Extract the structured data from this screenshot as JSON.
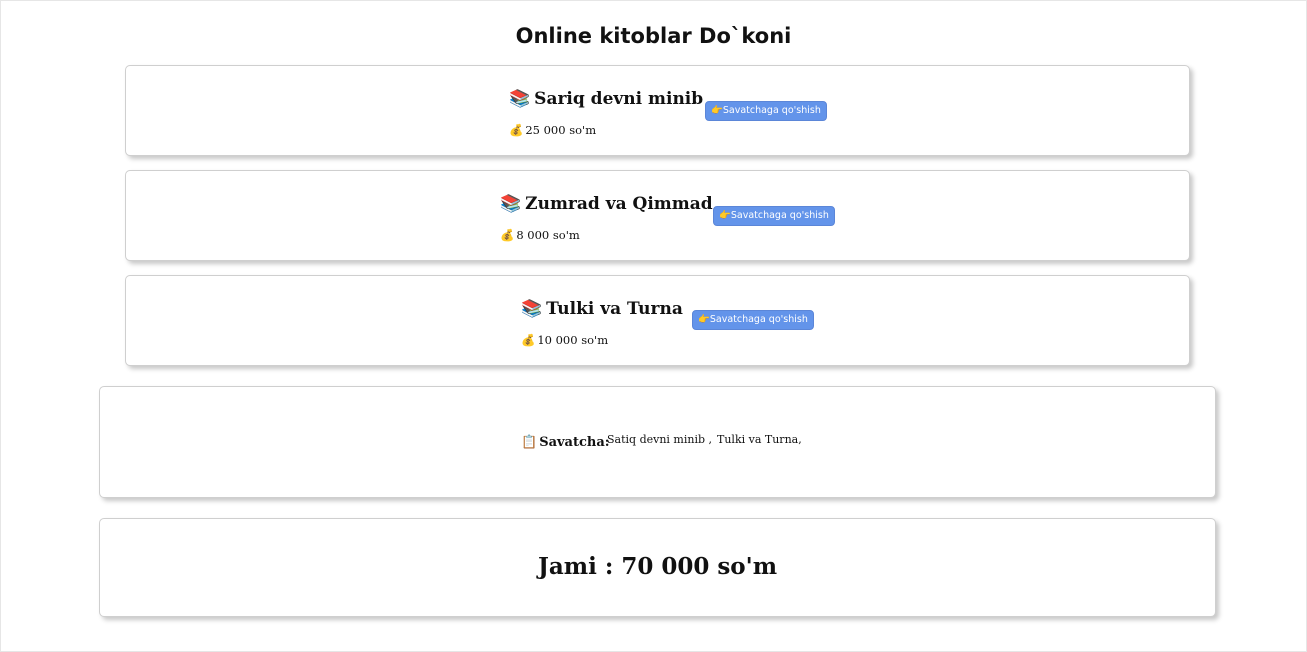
{
  "page": {
    "title": "Online kitoblar Do`koni"
  },
  "icons": {
    "book": "📚",
    "money": "💰",
    "pointer": "👉",
    "clipboard": "📋"
  },
  "books": [
    {
      "title": "Sariq devni minib",
      "price": "25 000 so'm",
      "button_label": "Savatchaga qo'shish"
    },
    {
      "title": "Zumrad va Qimmad",
      "price": "8 000 so'm",
      "button_label": "Savatchaga qo'shish"
    },
    {
      "title": "Tulki va Turna",
      "price": "10 000 so'm",
      "button_label": "Savatchaga qo'shish"
    }
  ],
  "cart": {
    "label": "Savatcha:",
    "items": [
      "Satiq devni minib ,",
      "Tulki va Turna,"
    ]
  },
  "total": {
    "label": "Jami :",
    "value": "70 000 so'm"
  },
  "colors": {
    "button_bg": "#6394ea",
    "button_text": "#ffffff"
  }
}
